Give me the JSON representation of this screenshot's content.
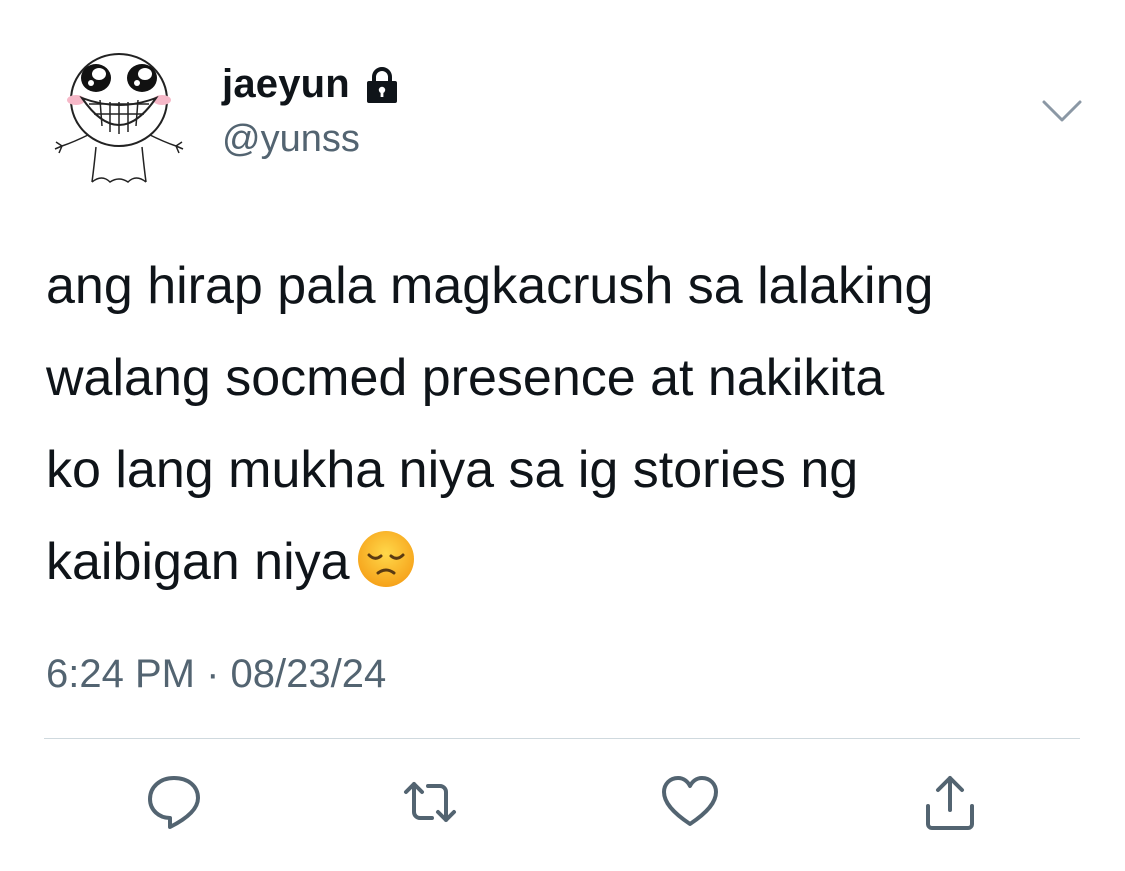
{
  "user": {
    "display_name": "jaeyun",
    "handle": "@yunss",
    "protected_icon": "lock-icon",
    "avatar_icon": "cartoon-smiley-avatar"
  },
  "tweet": {
    "lines": [
      "ang hirap pala magkacrush sa lalaking",
      "walang socmed presence at nakikita",
      "ko lang mukha niya sa ig stories ng",
      "kaibigan niya"
    ],
    "emoji": "disappointed-face-emoji",
    "timestamp": "6:24 PM · 08/23/24"
  },
  "actions": [
    {
      "name": "reply",
      "icon": "reply-icon"
    },
    {
      "name": "retweet",
      "icon": "retweet-icon"
    },
    {
      "name": "like",
      "icon": "heart-icon"
    },
    {
      "name": "share",
      "icon": "share-icon"
    }
  ],
  "colors": {
    "text_primary": "#0f1419",
    "text_secondary": "#536471",
    "icon": "#536471",
    "divider": "#cfd9de"
  }
}
